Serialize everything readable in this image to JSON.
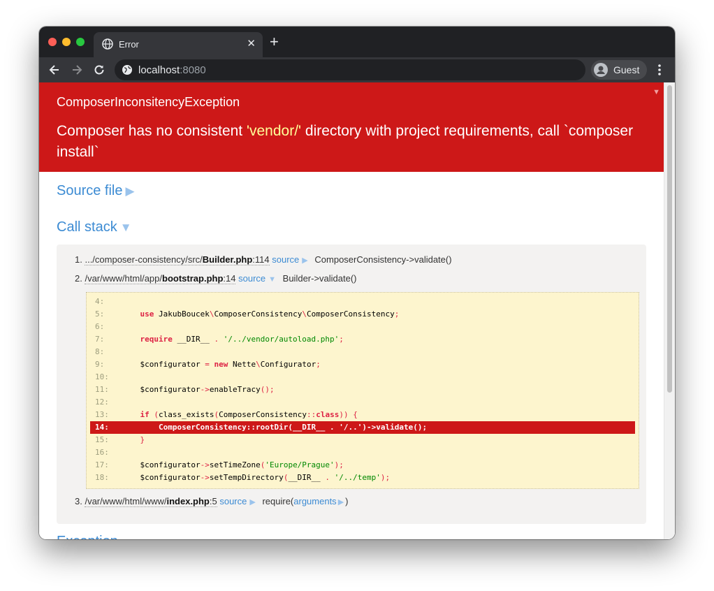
{
  "browser": {
    "tab_title": "Error",
    "tab_close": "✕",
    "new_tab": "+",
    "url_host": "localhost",
    "url_port": ":8080",
    "profile_name": "Guest"
  },
  "exception": {
    "type": "ComposerInconsitencyException",
    "message_before": "Composer has no consistent ",
    "message_highlight": "'vendor/'",
    "message_after": " directory with project requirements, call `composer install`",
    "toggle": "▼"
  },
  "sections": {
    "source_file": "Source file",
    "source_file_arrow": "▶",
    "call_stack": "Call stack",
    "call_stack_arrow": "▼",
    "next_section": "Exception"
  },
  "stack": [
    {
      "num": "1.",
      "path": ".../composer-consistency/src/",
      "file": "Builder.php",
      "line": ":114",
      "source_label": "source",
      "source_arrow": "▶",
      "call": "ComposerConsistency->validate()"
    },
    {
      "num": "2.",
      "path": "/var/www/html/app/",
      "file": "bootstrap.php",
      "line": ":14",
      "source_label": "source",
      "source_arrow": "▼",
      "call": "Builder->validate()"
    },
    {
      "num": "3.",
      "path": "/var/www/html/www/",
      "file": "index.php",
      "line": ":5",
      "source_label": "source",
      "source_arrow": "▶",
      "call_prefix": "require(",
      "call_args": "arguments",
      "call_args_arrow": "▶",
      "call_suffix": ")"
    }
  ],
  "code": {
    "highlight_line": "14:",
    "lines": [
      {
        "n": "4:"
      },
      {
        "n": "5:"
      },
      {
        "n": "6:"
      },
      {
        "n": "7:"
      },
      {
        "n": "8:"
      },
      {
        "n": "9:"
      },
      {
        "n": "10:"
      },
      {
        "n": "11:"
      },
      {
        "n": "12:"
      },
      {
        "n": "13:"
      },
      {
        "n": "14:"
      },
      {
        "n": "15:"
      },
      {
        "n": "16:"
      },
      {
        "n": "17:"
      },
      {
        "n": "18:"
      }
    ]
  },
  "colors": {
    "error_red": "#cd1818",
    "link_blue": "#3c8bd3",
    "code_bg": "#fdf5ce"
  }
}
